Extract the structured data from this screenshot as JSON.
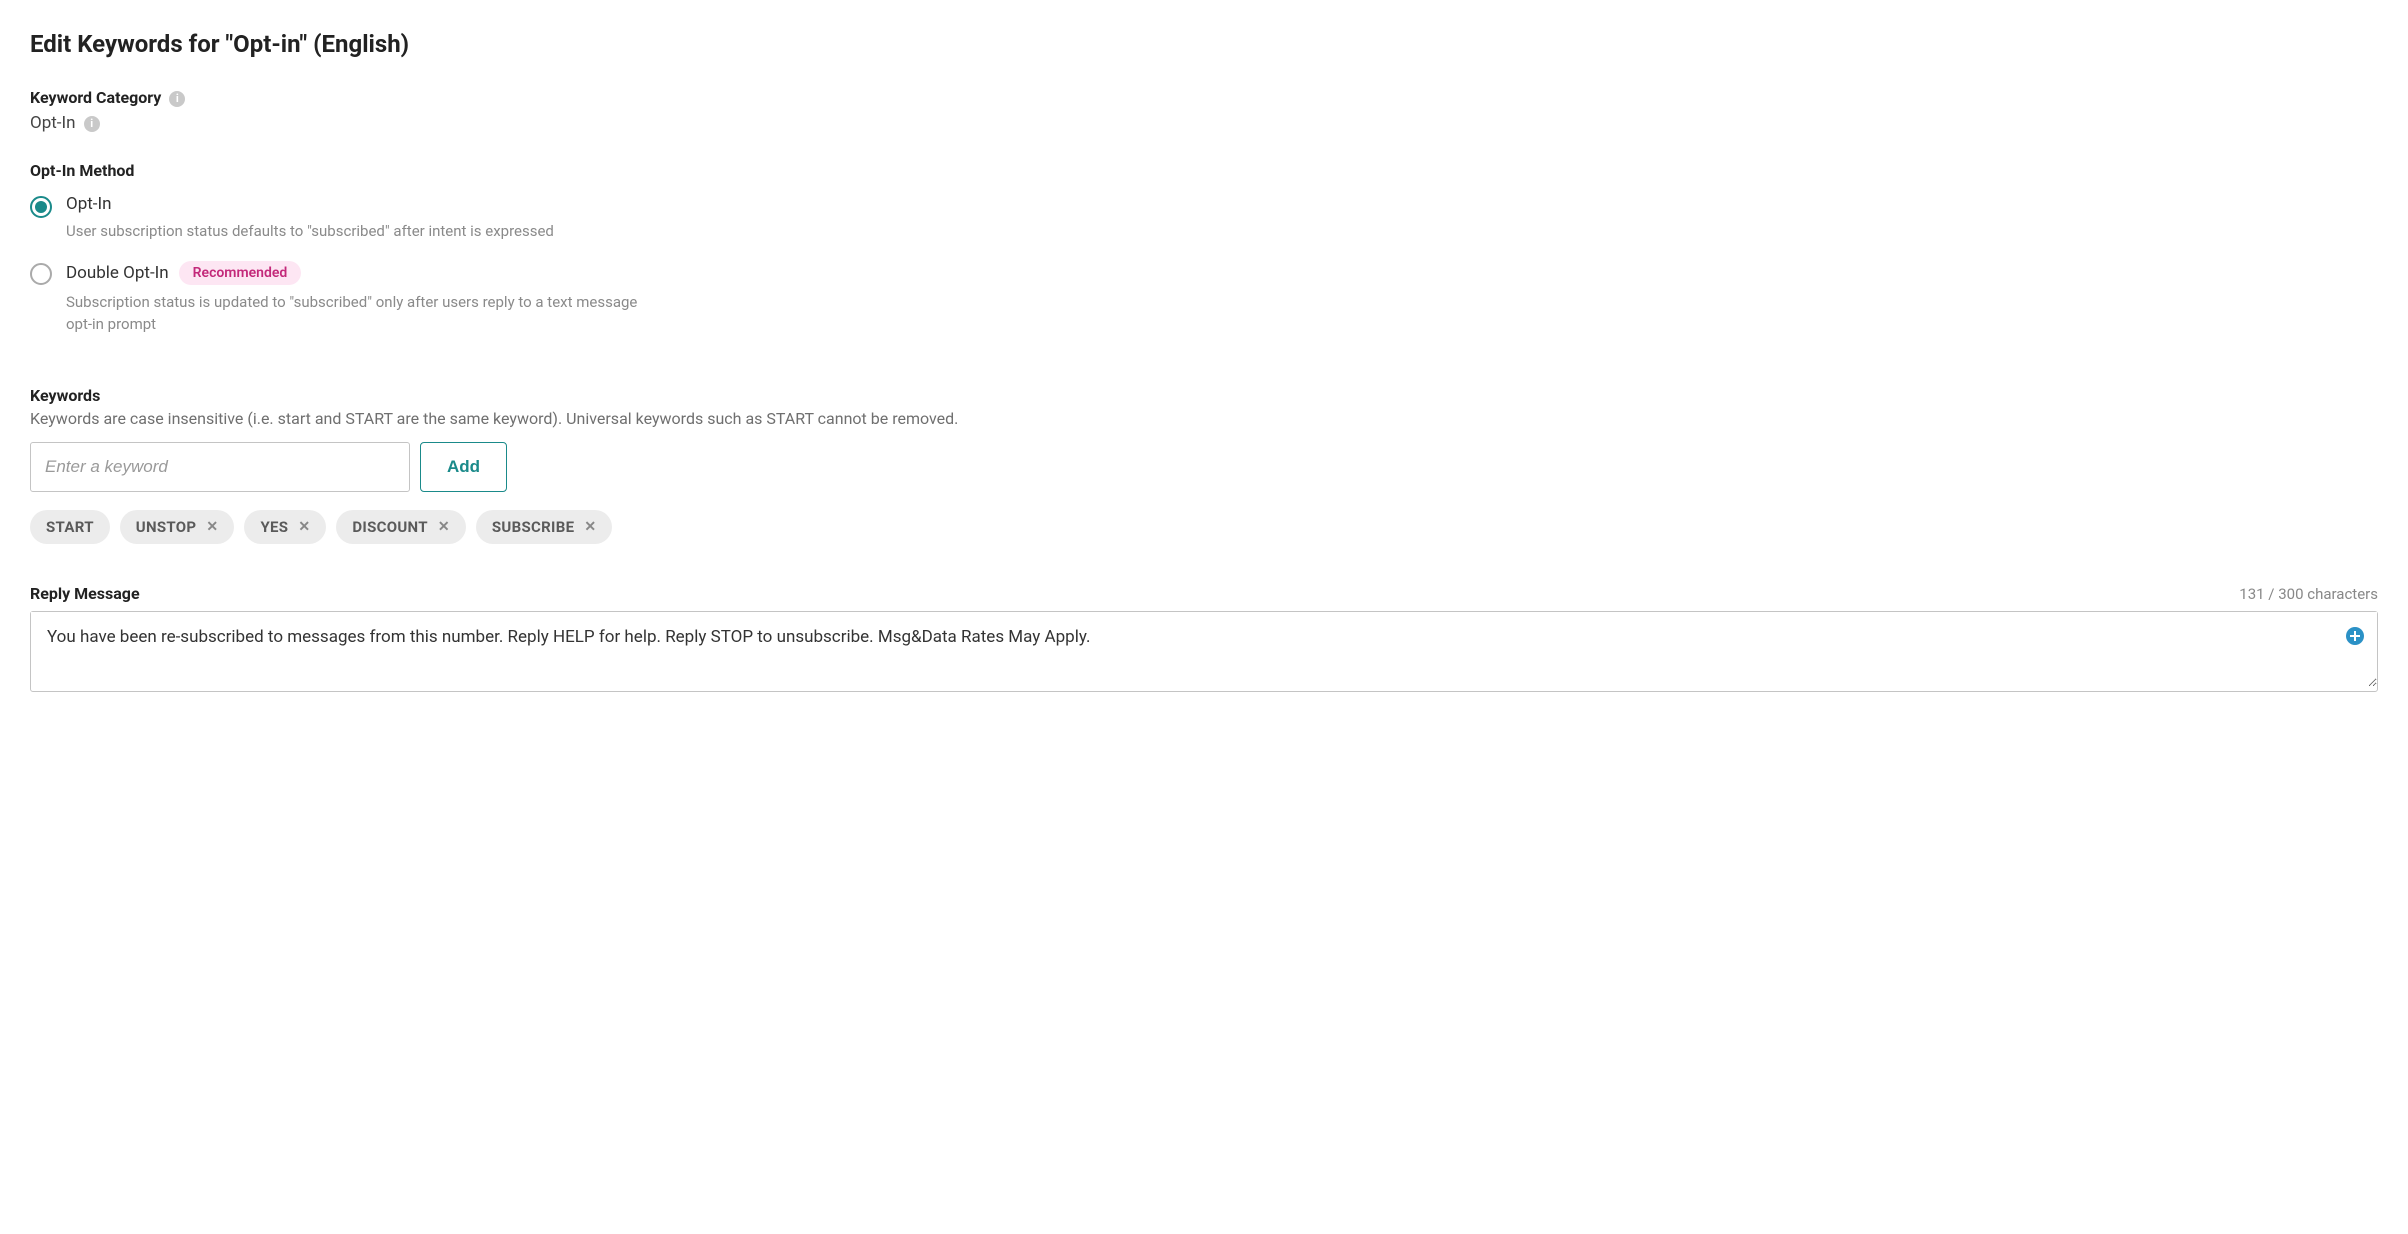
{
  "title": "Edit Keywords for \"Opt-in\" (English)",
  "category": {
    "label": "Keyword Category",
    "value": "Opt-In"
  },
  "method": {
    "label": "Opt-In Method",
    "options": [
      {
        "title": "Opt-In",
        "desc": "User subscription status defaults to \"subscribed\" after intent is expressed",
        "selected": true
      },
      {
        "title": "Double Opt-In",
        "badge": "Recommended",
        "desc": "Subscription status is updated to \"subscribed\" only after users reply to a text message opt-in prompt",
        "selected": false
      }
    ]
  },
  "keywords": {
    "label": "Keywords",
    "hint": "Keywords are case insensitive (i.e. start and START are the same keyword). Universal keywords such as START cannot be removed.",
    "placeholder": "Enter a keyword",
    "add_label": "Add",
    "items": [
      {
        "text": "START",
        "removable": false
      },
      {
        "text": "UNSTOP",
        "removable": true
      },
      {
        "text": "YES",
        "removable": true
      },
      {
        "text": "DISCOUNT",
        "removable": true
      },
      {
        "text": "SUBSCRIBE",
        "removable": true
      }
    ]
  },
  "reply": {
    "label": "Reply Message",
    "count": "131 / 300 characters",
    "text": "You have been re-subscribed to messages from this number. Reply HELP for help. Reply STOP to unsubscribe. Msg&Data Rates May Apply."
  }
}
